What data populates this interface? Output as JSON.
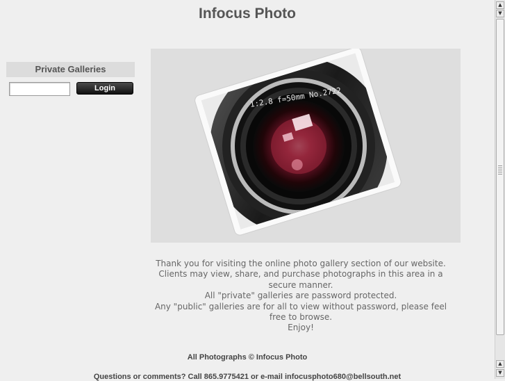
{
  "header": {
    "title": "Infocus Photo"
  },
  "sidebar": {
    "heading": "Private Galleries",
    "login_input": {
      "value": "",
      "placeholder": ""
    },
    "login_button": "Login"
  },
  "hero": {
    "icon": "camera-lens-photo"
  },
  "intro": {
    "lines": [
      "Thank you for visiting the online photo gallery section of our website.",
      "Clients may view, share, and purchase photographs in this area in a secure manner.",
      "All \"private\" galleries are password protected.",
      "Any \"public\" galleries are for all to view without password, please feel free to browse.",
      "Enjoy!"
    ]
  },
  "footer": {
    "copyright": "All Photographs © Infocus Photo",
    "contact": "Questions or comments? Call 865.9775421 or e-mail infocusphoto680@bellsouth.net"
  },
  "scrollbar": {
    "up_icon": "arrow-up-icon",
    "down_icon": "arrow-down-icon"
  }
}
